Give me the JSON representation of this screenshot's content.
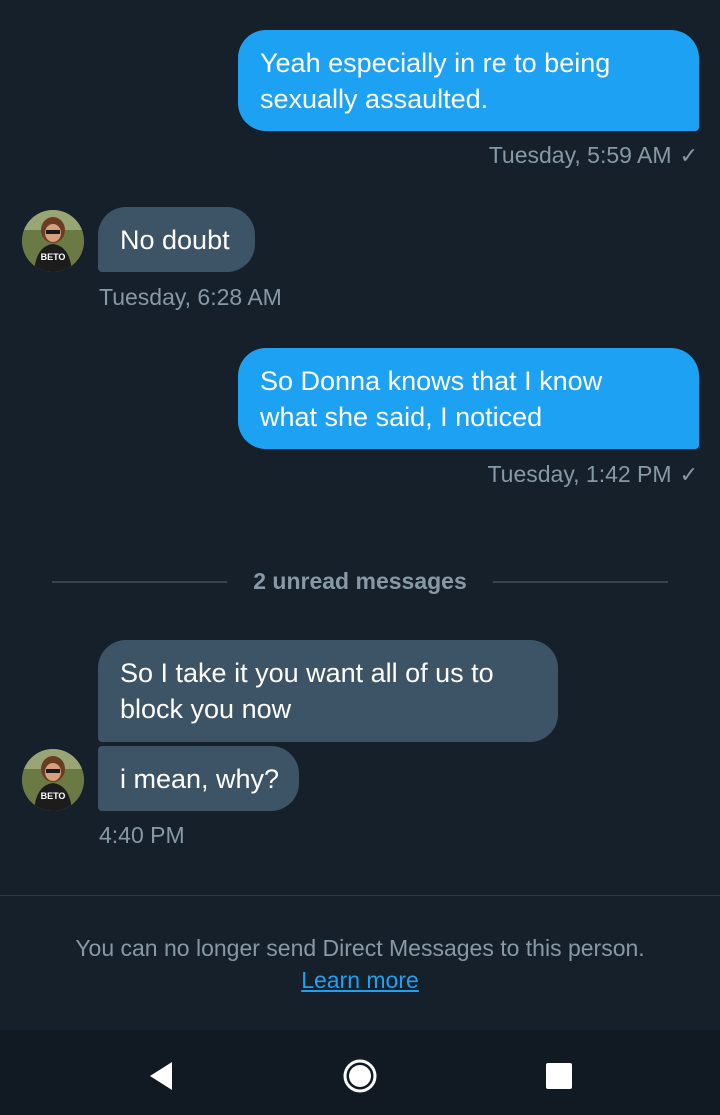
{
  "conversation": {
    "messages": [
      {
        "direction": "outgoing",
        "lines": [
          "Yeah especially in re to being",
          "sexually assaulted."
        ],
        "timestamp": "Tuesday, 5:59 AM",
        "read_receipt_icon": "checkmark-icon"
      },
      {
        "direction": "incoming",
        "lines": [
          "No doubt"
        ],
        "timestamp": "Tuesday, 6:28 AM",
        "avatar": "profile-photo"
      },
      {
        "direction": "outgoing",
        "lines": [
          "So Donna knows that I know",
          "what she said, I noticed"
        ],
        "timestamp": "Tuesday, 1:42 PM",
        "read_receipt_icon": "checkmark-icon"
      },
      {
        "direction": "incoming",
        "lines": [
          "So I take it you want all of us to",
          "block you now"
        ]
      },
      {
        "direction": "incoming",
        "lines": [
          "i mean, why?"
        ],
        "timestamp": "4:40 PM",
        "avatar": "profile-photo"
      }
    ],
    "unread_divider": "2 unread messages"
  },
  "footer": {
    "notice": "You can no longer send Direct Messages to this person.",
    "learn_more": "Learn more"
  },
  "navbar": {
    "back_icon": "back-triangle-icon",
    "home_icon": "home-circle-icon",
    "recents_icon": "recents-square-icon"
  },
  "colors": {
    "background": "#15202b",
    "outgoing_bubble": "#1da1f2",
    "incoming_bubble": "#3d5466",
    "secondary_text": "#8899a6",
    "link": "#1da1f2"
  }
}
